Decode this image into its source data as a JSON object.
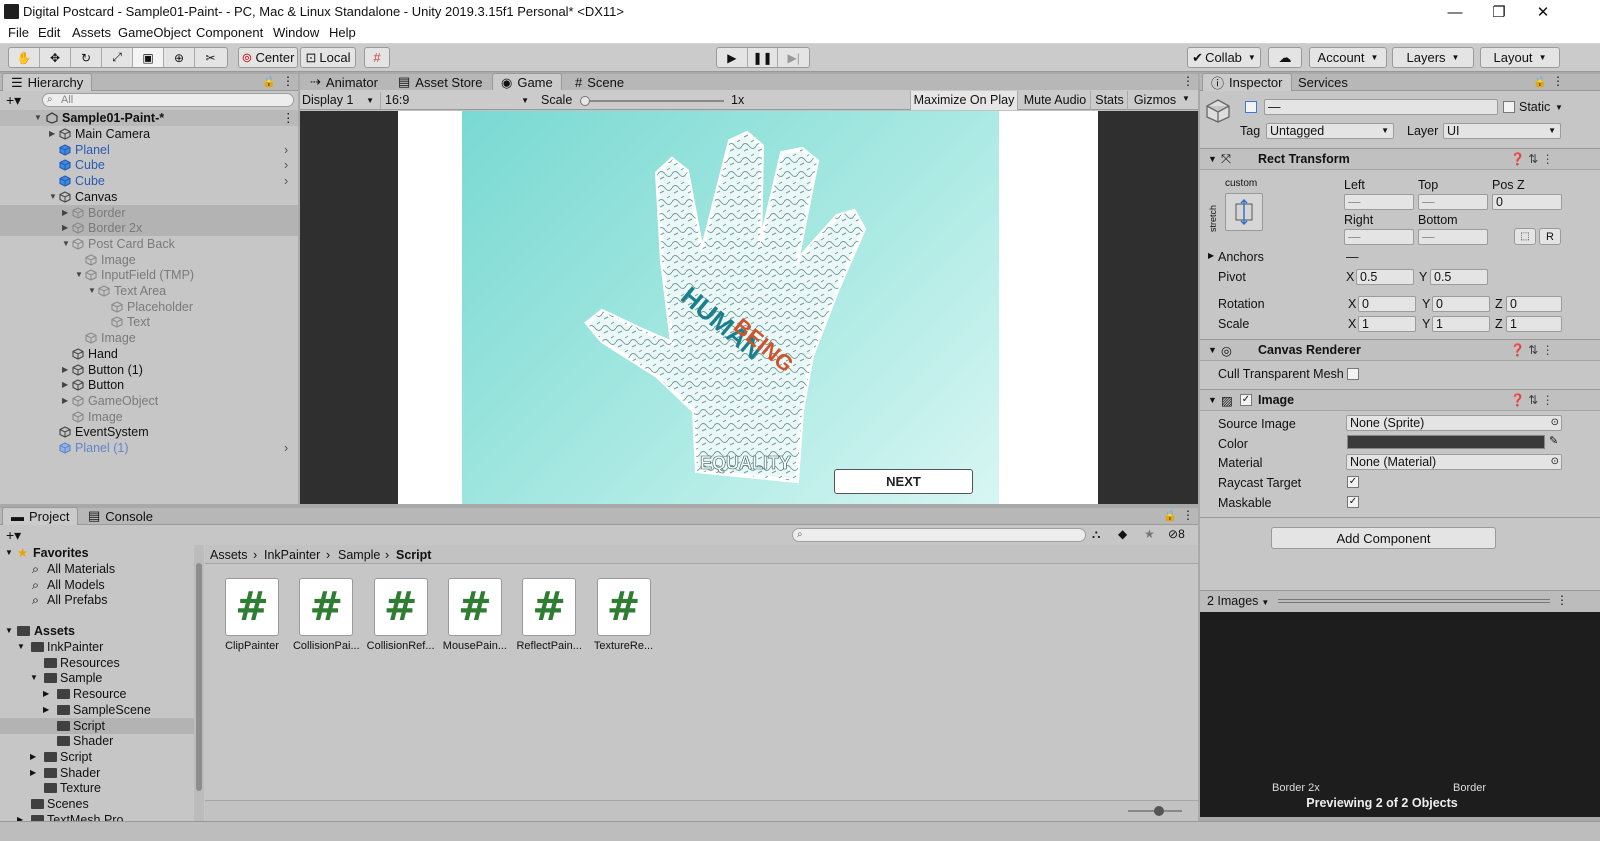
{
  "window": {
    "title": "Digital Postcard - Sample01-Paint- - PC, Mac & Linux Standalone - Unity 2019.3.15f1 Personal* <DX11>"
  },
  "menu": [
    "File",
    "Edit",
    "Assets",
    "GameObject",
    "Component",
    "Window",
    "Help"
  ],
  "toolbar": {
    "pivot_label": "Center",
    "space_label": "Local",
    "collab_label": "Collab",
    "account_label": "Account",
    "layers_label": "Layers",
    "layout_label": "Layout"
  },
  "hierarchy": {
    "tab": "Hierarchy",
    "search_placeholder": "All",
    "scene": "Sample01-Paint-*",
    "items": [
      {
        "label": "Main Camera",
        "tone": "",
        "arrow": "▶",
        "indent": 1,
        "icon": "cube-outline"
      },
      {
        "label": "Planel",
        "tone": "blue",
        "arrow": "",
        "indent": 1,
        "icon": "cube-blue",
        "child": true
      },
      {
        "label": "Cube",
        "tone": "blue",
        "arrow": "",
        "indent": 1,
        "icon": "cube-blue",
        "child": true
      },
      {
        "label": "Cube",
        "tone": "blue",
        "arrow": "",
        "indent": 1,
        "icon": "cube-blue",
        "child": true
      },
      {
        "label": "Canvas",
        "tone": "",
        "arrow": "▼",
        "indent": 1,
        "icon": "cube-outline"
      },
      {
        "label": "Border",
        "tone": "gray",
        "arrow": "▶",
        "indent": 2,
        "icon": "cube-gray",
        "selected": true
      },
      {
        "label": "Border 2x",
        "tone": "gray",
        "arrow": "▶",
        "indent": 2,
        "icon": "cube-gray",
        "selected": true
      },
      {
        "label": "Post Card Back",
        "tone": "gray",
        "arrow": "▼",
        "indent": 2,
        "icon": "cube-gray"
      },
      {
        "label": "Image",
        "tone": "gray",
        "arrow": "",
        "indent": 3,
        "icon": "cube-gray"
      },
      {
        "label": "InputField (TMP)",
        "tone": "gray",
        "arrow": "▼",
        "indent": 3,
        "icon": "cube-gray"
      },
      {
        "label": "Text Area",
        "tone": "gray",
        "arrow": "▼",
        "indent": 4,
        "icon": "cube-gray"
      },
      {
        "label": "Placeholder",
        "tone": "gray",
        "arrow": "",
        "indent": 5,
        "icon": "cube-gray"
      },
      {
        "label": "Text",
        "tone": "gray",
        "arrow": "",
        "indent": 5,
        "icon": "cube-gray"
      },
      {
        "label": "Image",
        "tone": "gray",
        "arrow": "",
        "indent": 3,
        "icon": "cube-gray"
      },
      {
        "label": "Hand",
        "tone": "",
        "arrow": "",
        "indent": 2,
        "icon": "cube-outline"
      },
      {
        "label": "Button (1)",
        "tone": "",
        "arrow": "▶",
        "indent": 2,
        "icon": "cube-outline"
      },
      {
        "label": "Button",
        "tone": "",
        "arrow": "▶",
        "indent": 2,
        "icon": "cube-outline"
      },
      {
        "label": "GameObject",
        "tone": "gray",
        "arrow": "▶",
        "indent": 2,
        "icon": "cube-gray"
      },
      {
        "label": "Image",
        "tone": "gray",
        "arrow": "",
        "indent": 2,
        "icon": "cube-gray"
      },
      {
        "label": "EventSystem",
        "tone": "",
        "arrow": "",
        "indent": 1,
        "icon": "cube-outline"
      },
      {
        "label": "Planel (1)",
        "tone": "lblue",
        "arrow": "",
        "indent": 1,
        "icon": "cube-lblue",
        "child": true
      }
    ]
  },
  "center_tabs": [
    "Animator",
    "Asset Store",
    "Game",
    "Scene"
  ],
  "game": {
    "display": "Display 1",
    "aspect": "16:9",
    "scale_label": "Scale",
    "scale_value": "1x",
    "scale_slider": 0,
    "maximize": "Maximize On Play",
    "mute": "Mute Audio",
    "stats": "Stats",
    "gizmos": "Gizmos",
    "hand_text_1": "HUMAN",
    "hand_text_2": "BEING",
    "hand_text_3": "EQUALITY",
    "next_button": "NEXT"
  },
  "inspector": {
    "tab": "Inspector",
    "tab2": "Services",
    "name_value": "—",
    "static_label": "Static",
    "tag_label": "Tag",
    "tag_value": "Untagged",
    "layer_label": "Layer",
    "layer_value": "UI",
    "rect": {
      "title": "Rect Transform",
      "anchor_preset": "custom",
      "stretch_label": "stretch",
      "left_label": "Left",
      "top_label": "Top",
      "posz_label": "Pos Z",
      "left": "—",
      "top": "—",
      "posz": "0",
      "right_label": "Right",
      "bottom_label": "Bottom",
      "right": "—",
      "bottom": "—",
      "r_button": "R",
      "anchors_label": "Anchors",
      "anchors_value": "—",
      "pivot_label": "Pivot",
      "pivot_x": "0.5",
      "pivot_y": "0.5",
      "rotation_label": "Rotation",
      "rot_x": "0",
      "rot_y": "0",
      "rot_z": "0",
      "scale_label": "Scale",
      "scale_x": "1",
      "scale_y": "1",
      "scale_z": "1",
      "x": "X",
      "y": "Y",
      "z": "Z"
    },
    "canvas_renderer": {
      "title": "Canvas Renderer",
      "cull_label": "Cull Transparent Mesh"
    },
    "image": {
      "title": "Image",
      "source_label": "Source Image",
      "source_value": "None (Sprite)",
      "color_label": "Color",
      "color_value": "#3a3a3a",
      "material_label": "Material",
      "material_value": "None (Material)",
      "raycast_label": "Raycast Target",
      "maskable_label": "Maskable"
    },
    "add_component": "Add Component",
    "preview": {
      "label": "2 Images",
      "item1": "Border 2x",
      "item2": "Border",
      "footer": "Previewing 2 of 2 Objects"
    }
  },
  "project": {
    "tab": "Project",
    "tab2": "Console",
    "hidden_count": "8",
    "breadcrumb": [
      "Assets",
      "InkPainter",
      "Sample",
      "Script"
    ],
    "favorites_label": "Favorites",
    "favorites": [
      "All Materials",
      "All Models",
      "All Prefabs"
    ],
    "assets_label": "Assets",
    "tree": [
      {
        "label": "InkPainter",
        "arrow": "▼",
        "indent": 1
      },
      {
        "label": "Resources",
        "arrow": "",
        "indent": 2
      },
      {
        "label": "Sample",
        "arrow": "▼",
        "indent": 2
      },
      {
        "label": "Resource",
        "arrow": "▶",
        "indent": 3
      },
      {
        "label": "SampleScene",
        "arrow": "▶",
        "indent": 3
      },
      {
        "label": "Script",
        "arrow": "",
        "indent": 3,
        "selected": true
      },
      {
        "label": "Shader",
        "arrow": "",
        "indent": 3
      },
      {
        "label": "Script",
        "arrow": "▶",
        "indent": 2
      },
      {
        "label": "Shader",
        "arrow": "▶",
        "indent": 2
      },
      {
        "label": "Texture",
        "arrow": "",
        "indent": 2
      },
      {
        "label": "Scenes",
        "arrow": "",
        "indent": 1
      },
      {
        "label": "TextMesh Pro",
        "arrow": "▶",
        "indent": 1
      }
    ],
    "files": [
      "ClipPainter",
      "CollisionPai...",
      "CollisionRef...",
      "MousePain...",
      "ReflectPain...",
      "TextureRe..."
    ]
  }
}
